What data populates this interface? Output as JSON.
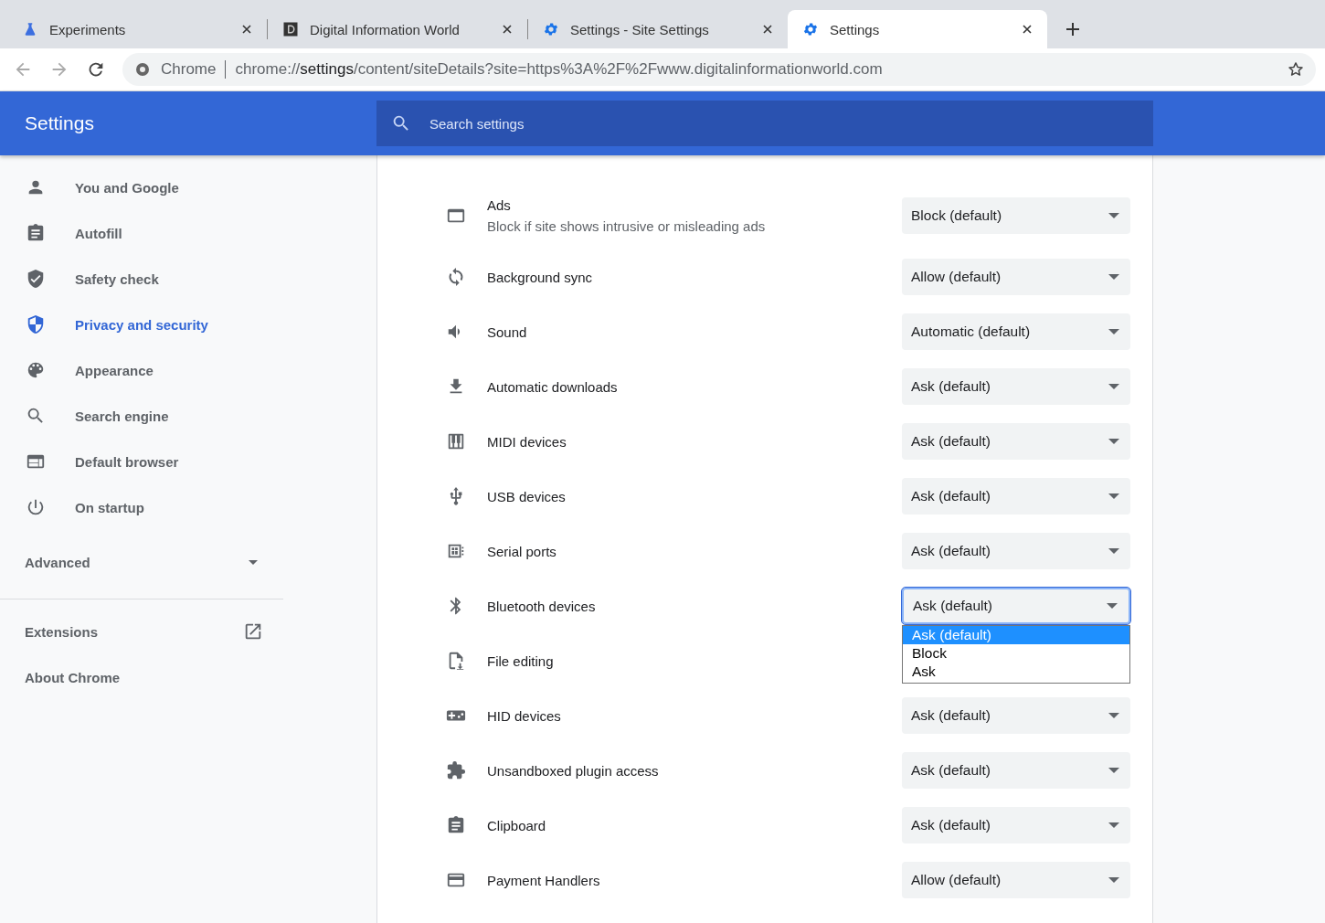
{
  "tabs": [
    {
      "title": "Experiments",
      "selected": false
    },
    {
      "title": "Digital Information World",
      "selected": false
    },
    {
      "title": "Settings - Site Settings",
      "selected": false
    },
    {
      "title": "Settings",
      "selected": true
    }
  ],
  "omnibox": {
    "site_label": "Chrome",
    "url_prefix": "chrome://",
    "url_host": "settings",
    "url_rest": "/content/siteDetails?site=https%3A%2F%2Fwww.digitalinformationworld.com"
  },
  "header": {
    "title": "Settings",
    "search": {
      "placeholder": "Search settings"
    }
  },
  "sidebar": {
    "items": [
      {
        "label": "You and Google",
        "selected": false
      },
      {
        "label": "Autofill",
        "selected": false
      },
      {
        "label": "Safety check",
        "selected": false
      },
      {
        "label": "Privacy and security",
        "selected": true
      },
      {
        "label": "Appearance",
        "selected": false
      },
      {
        "label": "Search engine",
        "selected": false
      },
      {
        "label": "Default browser",
        "selected": false
      },
      {
        "label": "On startup",
        "selected": false
      }
    ],
    "advanced": {
      "label": "Advanced",
      "expanded": false
    },
    "links": [
      {
        "label": "Extensions",
        "external": true
      },
      {
        "label": "About Chrome",
        "external": false
      }
    ]
  },
  "permissions": [
    {
      "name": "Ads",
      "description": "Block if site shows intrusive or misleading ads",
      "value": "Block (default)"
    },
    {
      "name": "Background sync",
      "value": "Allow (default)"
    },
    {
      "name": "Sound",
      "value": "Automatic (default)"
    },
    {
      "name": "Automatic downloads",
      "value": "Ask (default)"
    },
    {
      "name": "MIDI devices",
      "value": "Ask (default)"
    },
    {
      "name": "USB devices",
      "value": "Ask (default)"
    },
    {
      "name": "Serial ports",
      "value": "Ask (default)"
    },
    {
      "name": "Bluetooth devices",
      "value": "Ask (default)",
      "open": true,
      "options": [
        {
          "label": "Ask (default)",
          "selected": true
        },
        {
          "label": "Block",
          "selected": false
        },
        {
          "label": "Ask",
          "selected": false
        }
      ]
    },
    {
      "name": "File editing"
    },
    {
      "name": "HID devices",
      "value": "Ask (default)"
    },
    {
      "name": "Unsandboxed plugin access",
      "value": "Ask (default)"
    },
    {
      "name": "Clipboard",
      "value": "Ask (default)"
    },
    {
      "name": "Payment Handlers",
      "value": "Allow (default)"
    }
  ]
}
